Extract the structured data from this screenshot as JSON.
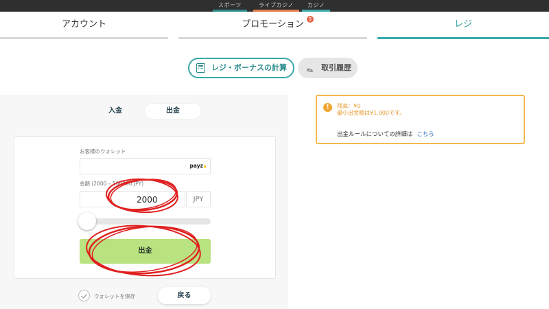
{
  "top_links": [
    "スポーツ",
    "ライブカジノ",
    "カジノ"
  ],
  "tabs": {
    "account": "アカウント",
    "promotion": "プロモーション",
    "promotion_badge": "5",
    "cashier": "レジ"
  },
  "subtabs": {
    "calculator": "レジ・ボーナスの計算",
    "history": "取引履歴"
  },
  "toggle": {
    "deposit": "入金",
    "withdraw": "出金"
  },
  "form": {
    "wallet_label": "お客様のウォレット",
    "wallet_provider": "payz",
    "amount_label": "金額 (2000 – 500000 JPY)",
    "amount_value": "2000",
    "currency": "JPY",
    "submit_label": "出金",
    "save_wallet_label": "ウォレットを保存",
    "back_label": "戻る"
  },
  "info": {
    "balance": "残高：¥0",
    "min_withdraw": "最小出金額は¥1,000です。",
    "rule_text": "出金ルールについての詳細は",
    "rule_link": "こちら"
  },
  "colors": {
    "accent_teal": "#3aa9a9",
    "submit_green": "#b9e280",
    "warning_orange": "#f2b84b",
    "annotation_red": "#e02020"
  }
}
